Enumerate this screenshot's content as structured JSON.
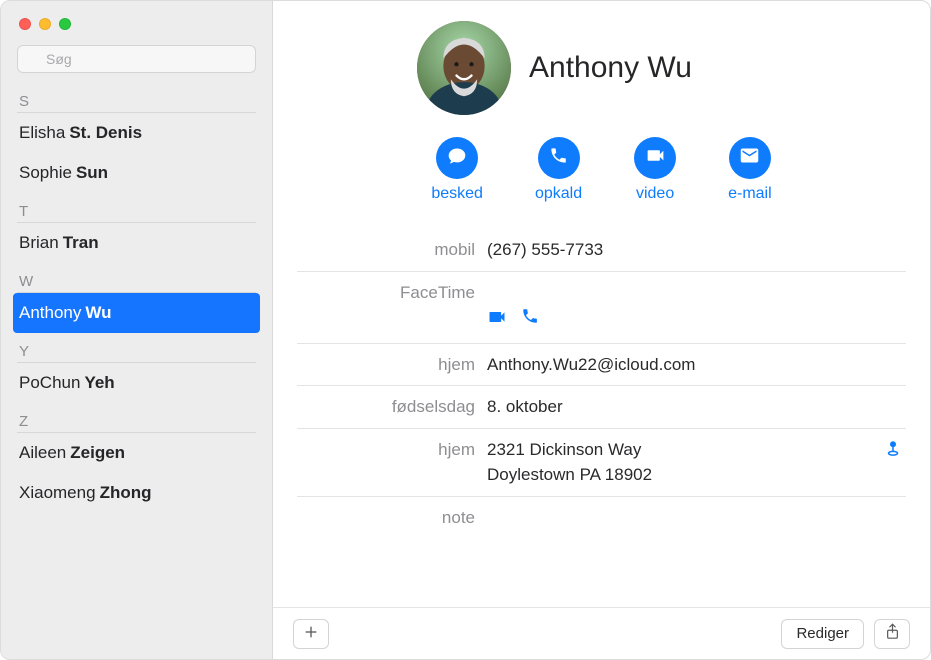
{
  "search": {
    "placeholder": "Søg",
    "value": ""
  },
  "sidebar": {
    "sections": [
      {
        "letter": "S",
        "contacts": [
          {
            "first": "Elisha",
            "last": "St. Denis",
            "selected": false
          },
          {
            "first": "Sophie",
            "last": "Sun",
            "selected": false
          }
        ]
      },
      {
        "letter": "T",
        "contacts": [
          {
            "first": "Brian",
            "last": "Tran",
            "selected": false
          }
        ]
      },
      {
        "letter": "W",
        "contacts": [
          {
            "first": "Anthony",
            "last": "Wu",
            "selected": true
          }
        ]
      },
      {
        "letter": "Y",
        "contacts": [
          {
            "first": "PoChun",
            "last": "Yeh",
            "selected": false
          }
        ]
      },
      {
        "letter": "Z",
        "contacts": [
          {
            "first": "Aileen",
            "last": "Zeigen",
            "selected": false
          },
          {
            "first": "Xiaomeng",
            "last": "Zhong",
            "selected": false
          }
        ]
      }
    ]
  },
  "card": {
    "name": "Anthony Wu",
    "actions": {
      "message": "besked",
      "call": "opkald",
      "video": "video",
      "email": "e-mail"
    },
    "fields": {
      "mobile_label": "mobil",
      "mobile_value": "(267) 555-7733",
      "facetime_label": "FaceTime",
      "home_email_label": "hjem",
      "home_email_value": "Anthony.Wu22@icloud.com",
      "birthday_label": "fødselsdag",
      "birthday_value": "8. oktober",
      "home_address_label": "hjem",
      "home_address_value": "2321 Dickinson Way\nDoylestown PA 18902",
      "note_label": "note",
      "note_value": ""
    }
  },
  "footer": {
    "edit": "Rediger"
  }
}
